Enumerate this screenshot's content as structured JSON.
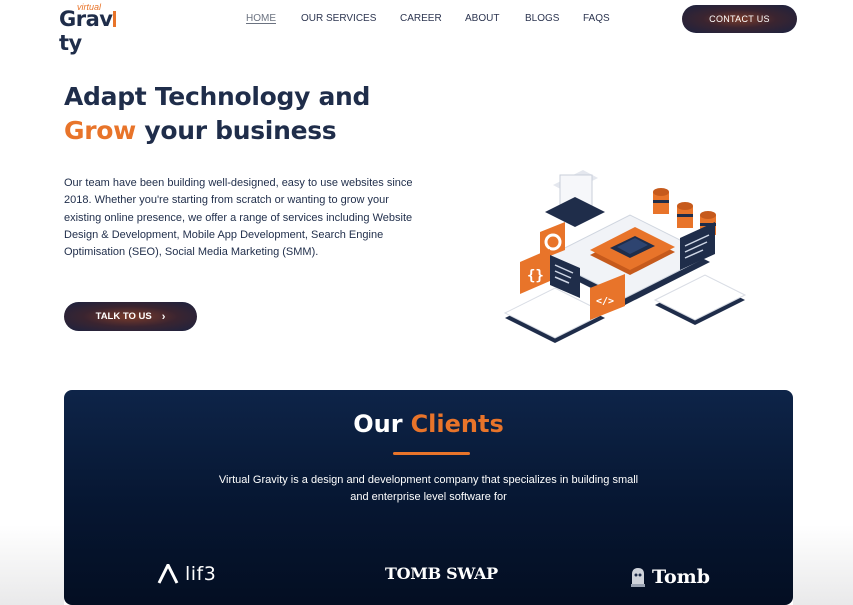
{
  "nav": {
    "logo_virtual": "virtual",
    "logo_main_left": "Grav",
    "logo_main_right": "ty",
    "items": [
      "HOME",
      "OUR SERVICES",
      "CAREER",
      "ABOUT",
      "BLOGS",
      "FAQS"
    ],
    "active": "HOME",
    "contact_label": "CONTACT US"
  },
  "hero": {
    "title_line1": "Adapt Technology and",
    "title_accent": "Grow",
    "title_line2_rest": " your business",
    "description": "Our team have been building well-designed, easy to use websites since 2018. Whether you're starting from scratch or wanting to grow your existing online presence, we offer a range of services including Website Design & Development, Mobile App Development, Search Engine Optimisation (SEO), Social Media Marketing (SMM).",
    "cta_label": "TALK TO US",
    "cta_icon": "chevron-right-icon"
  },
  "clients": {
    "title_plain": "Our",
    "title_accent": "Clients",
    "description": "Virtual Gravity is a design and development company that specializes in building small and enterprise level software for",
    "logos": [
      {
        "name": "lif3",
        "icon": "lambda-icon"
      },
      {
        "name": "TOMB SWAP"
      },
      {
        "name": "Tomb",
        "icon": "tombstone-icon"
      }
    ]
  },
  "colors": {
    "brand_navy": "#1f2d4a",
    "brand_orange": "#e8742a",
    "clients_bg": "#061631"
  }
}
